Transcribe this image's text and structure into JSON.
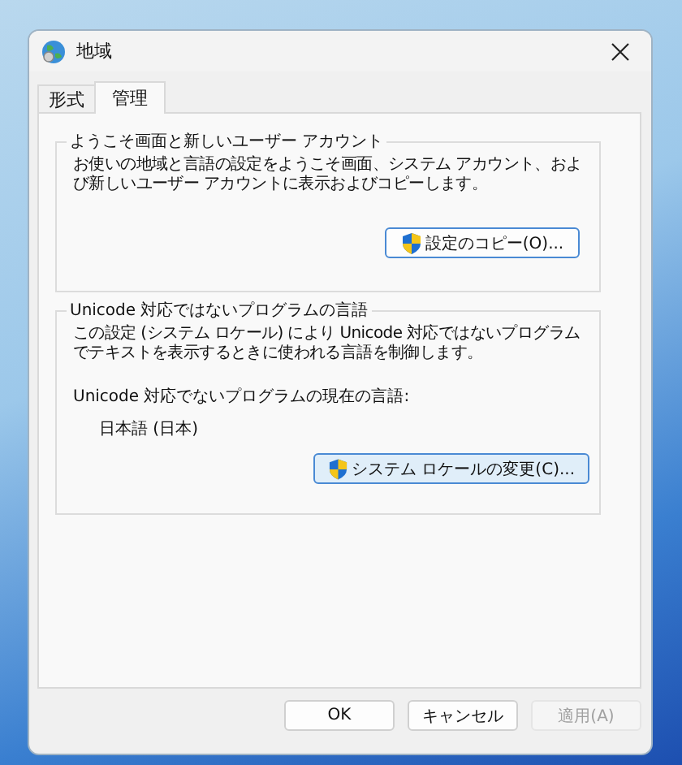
{
  "window": {
    "title": "地域"
  },
  "tabs": [
    {
      "label": "形式",
      "selected": false
    },
    {
      "label": "管理",
      "selected": true
    }
  ],
  "groups": [
    {
      "title": "ようこそ画面と新しいユーザー アカウント",
      "texts": [
        {
          "kind": "paragraph",
          "text": "お使いの地域と言語の設定をようこそ画面、システム アカウント、および新しいユーザー アカウントに表示およびコピーします。"
        }
      ],
      "button": {
        "label": "設定のコピー(O)...",
        "kind": "focused"
      }
    },
    {
      "title": "Unicode 対応ではないプログラムの言語",
      "texts": [
        {
          "kind": "paragraph",
          "text": "この設定 (システム ロケール) により Unicode 対応ではないプログラムでテキストを表示するときに使われる言語を制御します。"
        },
        {
          "kind": "label",
          "text": "Unicode 対応でないプログラムの現在の言語:"
        },
        {
          "kind": "value",
          "text": "日本語 (日本)"
        }
      ],
      "button": {
        "label": "システム ロケールの変更(C)...",
        "kind": "hot"
      }
    }
  ],
  "buttons": [
    {
      "label": "OK",
      "disabled": false
    },
    {
      "label": "キャンセル",
      "disabled": false
    },
    {
      "label": "適用(A)",
      "disabled": true
    }
  ]
}
